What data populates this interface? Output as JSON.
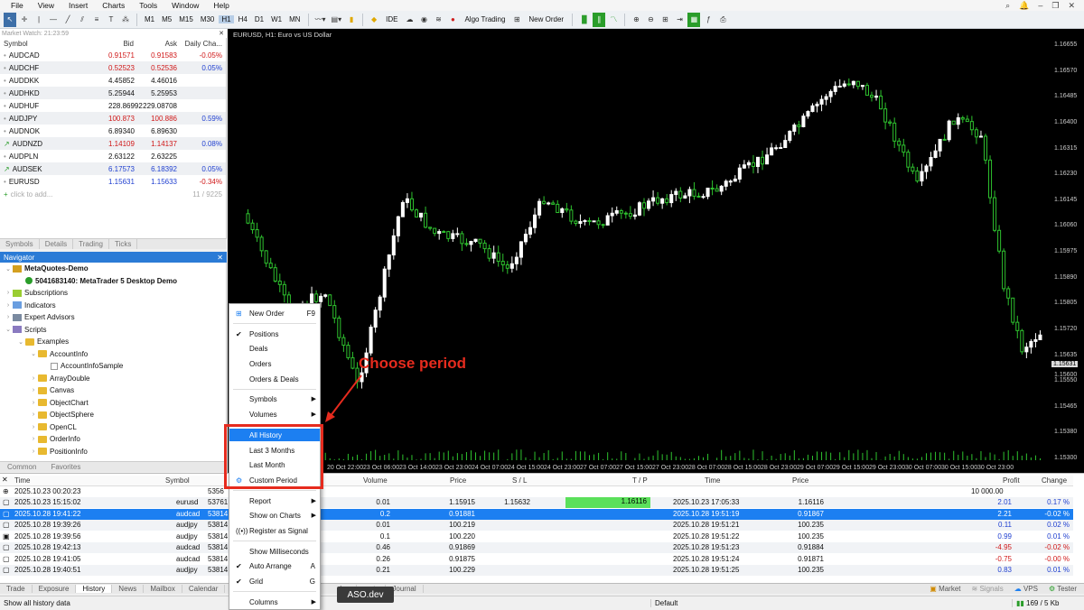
{
  "menu": [
    "File",
    "View",
    "Insert",
    "Charts",
    "Tools",
    "Window",
    "Help"
  ],
  "toolbar": {
    "timeframes": [
      "M1",
      "M5",
      "M15",
      "M30",
      "H1",
      "H4",
      "D1",
      "W1",
      "MN"
    ],
    "active_timeframe": "H1",
    "ide": "IDE",
    "algo_trading": "Algo Trading",
    "new_order": "New Order"
  },
  "market_watch": {
    "title": "Market Watch: 21:23:59",
    "headers": {
      "symbol": "Symbol",
      "bid": "Bid",
      "ask": "Ask",
      "change": "Daily Cha..."
    },
    "rows": [
      {
        "symbol": "AUDCAD",
        "bid": "0.91571",
        "ask": "0.91583",
        "change": "-0.05%",
        "bid_color": "red",
        "chg_color": "red"
      },
      {
        "symbol": "AUDCHF",
        "bid": "0.52523",
        "ask": "0.52536",
        "change": "0.05%",
        "bid_color": "red",
        "chg_color": "blue"
      },
      {
        "symbol": "AUDDKK",
        "bid": "4.45852",
        "ask": "4.46016",
        "change": "",
        "bid_color": "",
        "chg_color": ""
      },
      {
        "symbol": "AUDHKD",
        "bid": "5.25944",
        "ask": "5.25953",
        "change": "",
        "bid_color": "",
        "chg_color": ""
      },
      {
        "symbol": "AUDHUF",
        "bid": "228.86992",
        "ask": "229.08708",
        "change": "",
        "bid_color": "",
        "chg_color": ""
      },
      {
        "symbol": "AUDJPY",
        "bid": "100.873",
        "ask": "100.886",
        "change": "0.59%",
        "bid_color": "red",
        "chg_color": "blue"
      },
      {
        "symbol": "AUDNOK",
        "bid": "6.89340",
        "ask": "6.89630",
        "change": "",
        "bid_color": "",
        "chg_color": ""
      },
      {
        "symbol": "AUDNZD",
        "bid": "1.14109",
        "ask": "1.14137",
        "change": "0.08%",
        "bid_color": "red",
        "chg_color": "blue"
      },
      {
        "symbol": "AUDPLN",
        "bid": "2.63122",
        "ask": "2.63225",
        "change": "",
        "bid_color": "",
        "chg_color": ""
      },
      {
        "symbol": "AUDSEK",
        "bid": "6.17573",
        "ask": "6.18392",
        "change": "0.05%",
        "bid_color": "blue",
        "chg_color": "blue"
      },
      {
        "symbol": "EURUSD",
        "bid": "1.15631",
        "ask": "1.15633",
        "change": "-0.34%",
        "bid_color": "blue",
        "chg_color": "red"
      }
    ],
    "add_text": "click to add...",
    "count": "11 / 9225",
    "tabs": [
      "Symbols",
      "Details",
      "Trading",
      "Ticks"
    ]
  },
  "navigator": {
    "title": "Navigator",
    "items": [
      {
        "label": "MetaQuotes-Demo",
        "level": 0,
        "bold": true
      },
      {
        "label": "5041683140: MetaTrader 5 Desktop Demo",
        "level": 1,
        "bold": true
      },
      {
        "label": "Subscriptions",
        "level": 0
      },
      {
        "label": "Indicators",
        "level": 0
      },
      {
        "label": "Expert Advisors",
        "level": 0
      },
      {
        "label": "Scripts",
        "level": 0
      },
      {
        "label": "Examples",
        "level": 1
      },
      {
        "label": "AccountInfo",
        "level": 2
      },
      {
        "label": "AccountInfoSample",
        "level": 3
      },
      {
        "label": "ArrayDouble",
        "level": 2
      },
      {
        "label": "Canvas",
        "level": 2
      },
      {
        "label": "ObjectChart",
        "level": 2
      },
      {
        "label": "ObjectSphere",
        "level": 2
      },
      {
        "label": "OpenCL",
        "level": 2
      },
      {
        "label": "OrderInfo",
        "level": 2
      },
      {
        "label": "PositionInfo",
        "level": 2
      }
    ],
    "tabs": [
      "Common",
      "Favorites"
    ]
  },
  "chart": {
    "title": "EURUSD, H1:  Euro vs US Dollar",
    "prices": [
      "1.16655",
      "1.16570",
      "1.16485",
      "1.16400",
      "1.16315",
      "1.16230",
      "1.16145",
      "1.16060",
      "1.15975",
      "1.15890",
      "1.15805",
      "1.15720",
      "1.15635",
      "1.15550",
      "1.15465",
      "1.15380",
      "1.15300"
    ],
    "current_price": "1.15631",
    "extra_price": "1.15600",
    "times": [
      "20 Oct 22:00",
      "23 Oct 06:00",
      "23 Oct 14:00",
      "23 Oct 23:00",
      "24 Oct 07:00",
      "24 Oct 15:00",
      "24 Oct 23:00",
      "27 Oct 07:00",
      "27 Oct 15:00",
      "27 Oct 23:00",
      "28 Oct 07:00",
      "28 Oct 15:00",
      "28 Oct 23:00",
      "29 Oct 07:00",
      "29 Oct 15:00",
      "29 Oct 23:00",
      "30 Oct 07:00",
      "30 Oct 15:00",
      "30 Oct 23:00"
    ]
  },
  "history": {
    "headers": {
      "time": "Time",
      "symbol": "Symbol",
      "volume": "Volume",
      "price": "Price",
      "sl": "S / L",
      "tp": "T / P",
      "time2": "Time",
      "price2": "Price",
      "profit": "Profit",
      "change": "Change"
    },
    "balance_row": {
      "time": "2025.10.23 00:20:23",
      "ticket": "5356",
      "profit": "10 000.00"
    },
    "rows": [
      {
        "time": "2025.10.23 15:15:02",
        "symbol": "eurusd",
        "ticket": "53761",
        "volume": "0.01",
        "price": "1.15915",
        "sl": "1.15632",
        "tp": "1.16116",
        "time2": "2025.10.23 17:05:33",
        "price2": "1.16116",
        "profit": "2.01",
        "change": "0.17 %"
      },
      {
        "time": "2025.10.28 19:41:22",
        "symbol": "audcad",
        "ticket": "53814",
        "volume": "0.2",
        "price": "0.91881",
        "sl": "",
        "tp": "",
        "time2": "2025.10.28 19:51:19",
        "price2": "0.91867",
        "profit": "2.21",
        "change": "-0.02 %"
      },
      {
        "time": "2025.10.28 19:39:26",
        "symbol": "audjpy",
        "ticket": "53814",
        "volume": "0.01",
        "price": "100.219",
        "sl": "",
        "tp": "",
        "time2": "2025.10.28 19:51:21",
        "price2": "100.235",
        "profit": "0.11",
        "change": "0.02 %"
      },
      {
        "time": "2025.10.28 19:39:56",
        "symbol": "audjpy",
        "ticket": "53814",
        "volume": "0.1",
        "price": "100.220",
        "sl": "",
        "tp": "",
        "time2": "2025.10.28 19:51:22",
        "price2": "100.235",
        "profit": "0.99",
        "change": "0.01 %"
      },
      {
        "time": "2025.10.28 19:42:13",
        "symbol": "audcad",
        "ticket": "53814",
        "volume": "0.46",
        "price": "0.91869",
        "sl": "",
        "tp": "",
        "time2": "2025.10.28 19:51:23",
        "price2": "0.91884",
        "profit": "-4.95",
        "change": "-0.02 %"
      },
      {
        "time": "2025.10.28 19:41:05",
        "symbol": "audcad",
        "ticket": "53814",
        "volume": "0.26",
        "price": "0.91875",
        "sl": "",
        "tp": "",
        "time2": "2025.10.28 19:51:24",
        "price2": "0.91871",
        "profit": "-0.75",
        "change": "-0.00 %"
      },
      {
        "time": "2025.10.28 19:40:51",
        "symbol": "audjpy",
        "ticket": "53814",
        "volume": "0.21",
        "price": "100.229",
        "sl": "",
        "tp": "",
        "time2": "2025.10.28 19:51:25",
        "price2": "100.235",
        "profit": "0.83",
        "change": "0.01 %"
      }
    ]
  },
  "bottom_tabs": [
    "Trade",
    "Exposure",
    "History",
    "News",
    "Mailbox",
    "Calendar",
    "",
    "les",
    "perts",
    "Journal"
  ],
  "bottom_right": {
    "market": "Market",
    "signals": "Signals",
    "vps": "VPS",
    "tester": "Tester"
  },
  "status": {
    "left": "Show all history data",
    "middle": "Default",
    "right": "169 / 5 Kb"
  },
  "context_menu": {
    "new_order": "New Order",
    "new_order_key": "F9",
    "positions": "Positions",
    "deals": "Deals",
    "orders": "Orders",
    "orders_deals": "Orders & Deals",
    "symbols": "Symbols",
    "volumes": "Volumes",
    "all_history": "All History",
    "last3": "Last 3 Months",
    "last_month": "Last Month",
    "custom": "Custom Period",
    "report": "Report",
    "show_on_charts": "Show on Charts",
    "register_signal": "Register as Signal",
    "show_ms": "Show Milliseconds",
    "auto_arrange": "Auto Arrange",
    "auto_arrange_key": "A",
    "grid": "Grid",
    "grid_key": "G",
    "columns": "Columns"
  },
  "annotation": "Choose period",
  "watermark": "ASO.dev",
  "colors": {
    "accent": "#1c7ff1",
    "annotation": "#e62b1e",
    "bull": "#ffffff",
    "bear": "#2ec22e"
  }
}
